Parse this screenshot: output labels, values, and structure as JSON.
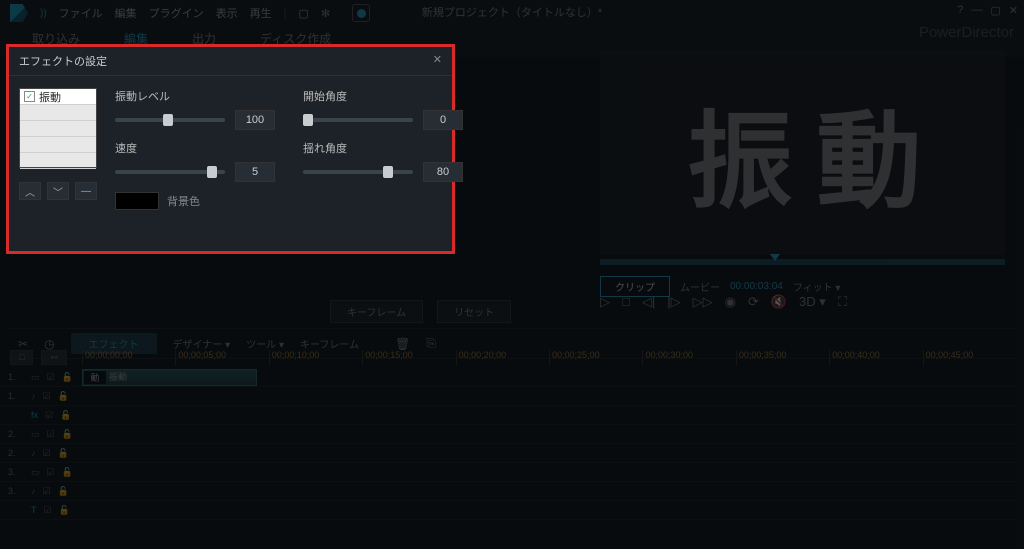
{
  "menu": {
    "file": "ファイル",
    "edit": "編集",
    "plugin": "プラグイン",
    "view": "表示",
    "play": "再生"
  },
  "title": "新規プロジェクト（タイトルなし）*",
  "brand": "PowerDirector",
  "tabs": {
    "capture": "取り込み",
    "edit": "編集",
    "out": "出力",
    "disc": "ディスク作成"
  },
  "fx": {
    "panel_title": "エフェクトの設定",
    "list_item": "振動",
    "p1": {
      "label": "振動レベル",
      "value": "100"
    },
    "p2": {
      "label": "開始角度",
      "value": "0"
    },
    "p3": {
      "label": "速度",
      "value": "5"
    },
    "p4": {
      "label": "揺れ角度",
      "value": "80"
    },
    "bg": "背景色"
  },
  "preview": {
    "char1": "振",
    "char2": "動"
  },
  "kf": {
    "kf": "キーフレーム",
    "reset": "リセット"
  },
  "play": {
    "clip": "クリップ",
    "movie": "ムービー",
    "tc": "00:00:03:04",
    "fit": "フィット"
  },
  "ctrl_3d": "3D ▾",
  "toolbar": {
    "fx": "エフェクト",
    "designer": "デザイナー",
    "tool": "ツール",
    "kf": "キーフレーム"
  },
  "ruler": [
    "00;00;00;00",
    "00;00;05;00",
    "00;00;10;00",
    "00;00;15;00",
    "00;00;20;00",
    "00;00;25;00",
    "00;00;30;00",
    "00;00;35;00",
    "00;00;40;00",
    "00;00;45;00"
  ],
  "clip": {
    "thumb": "動",
    "label": "振動"
  },
  "track_nums": [
    "1.",
    "1.",
    "",
    "2.",
    "2.",
    "3.",
    "3.",
    ""
  ]
}
